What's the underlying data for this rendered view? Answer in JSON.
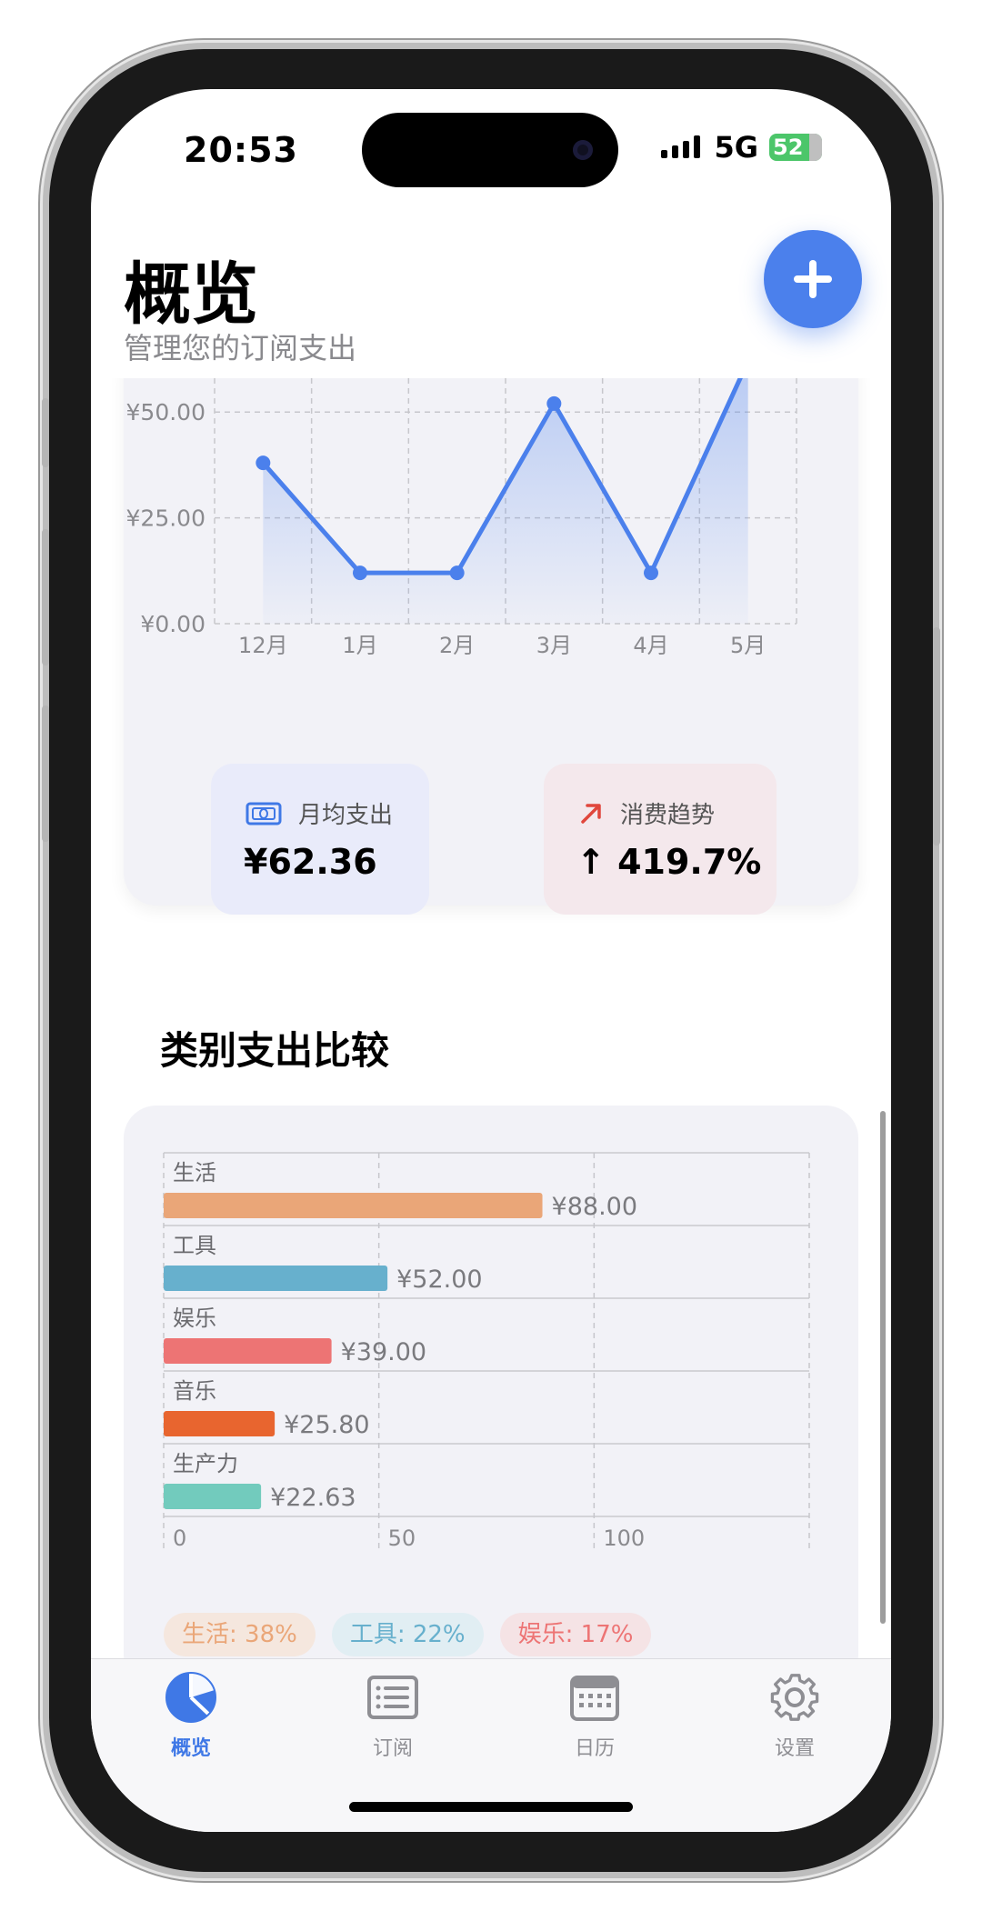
{
  "status_bar": {
    "time": "20:53",
    "network": "5G",
    "battery": "52"
  },
  "header": {
    "title": "概览",
    "subtitle": "管理您的订阅支出"
  },
  "colors": {
    "accent": "#4b80ec",
    "tab_active": "#3f78e6",
    "tab_inactive": "#8e8e93"
  },
  "trend_card": {
    "avg": {
      "label": "月均支出",
      "value": "¥62.36",
      "icon": "money-icon"
    },
    "trend": {
      "label": "消费趋势",
      "value": "↑ 419.7%",
      "icon": "arrow-up-right-icon"
    }
  },
  "category_section": {
    "title": "类别支出比较",
    "legend": [
      {
        "label": "生活: 38%",
        "color": "#eaa678",
        "bg": "#f5e7de"
      },
      {
        "label": "工具: 22%",
        "color": "#67b0cd",
        "bg": "#e1eef3"
      },
      {
        "label": "娱乐: 17%",
        "color": "#ed7474",
        "bg": "#f5e3e5"
      }
    ]
  },
  "tabs": [
    {
      "label": "概览",
      "icon": "pie-chart-icon",
      "active": true
    },
    {
      "label": "订阅",
      "icon": "list-icon",
      "active": false
    },
    {
      "label": "日历",
      "icon": "calendar-icon",
      "active": false
    },
    {
      "label": "设置",
      "icon": "gear-icon",
      "active": false
    }
  ],
  "chart_data": [
    {
      "type": "line",
      "categories": [
        "12月",
        "1月",
        "2月",
        "3月",
        "4月",
        "5月"
      ],
      "values": [
        38.0,
        12.0,
        12.0,
        52.0,
        12.0,
        62.0
      ],
      "ytick_labels": [
        "¥0.00",
        "¥25.00",
        "¥50.00"
      ],
      "yticks": [
        0,
        25,
        50
      ],
      "ylim": [
        0,
        58
      ],
      "grid": true,
      "area_fill": true
    },
    {
      "type": "bar",
      "orientation": "horizontal",
      "categories": [
        "生活",
        "工具",
        "娱乐",
        "音乐",
        "生产力"
      ],
      "values": [
        88.0,
        52.0,
        39.0,
        25.8,
        22.63
      ],
      "value_labels": [
        "¥88.00",
        "¥52.00",
        "¥39.00",
        "¥25.80",
        "¥22.63"
      ],
      "colors": [
        "#eaa678",
        "#67b0cd",
        "#ed7474",
        "#e8652f",
        "#72cbbd"
      ],
      "xticks": [
        0,
        50,
        100
      ],
      "xlim": [
        0,
        150
      ],
      "grid": true
    }
  ]
}
